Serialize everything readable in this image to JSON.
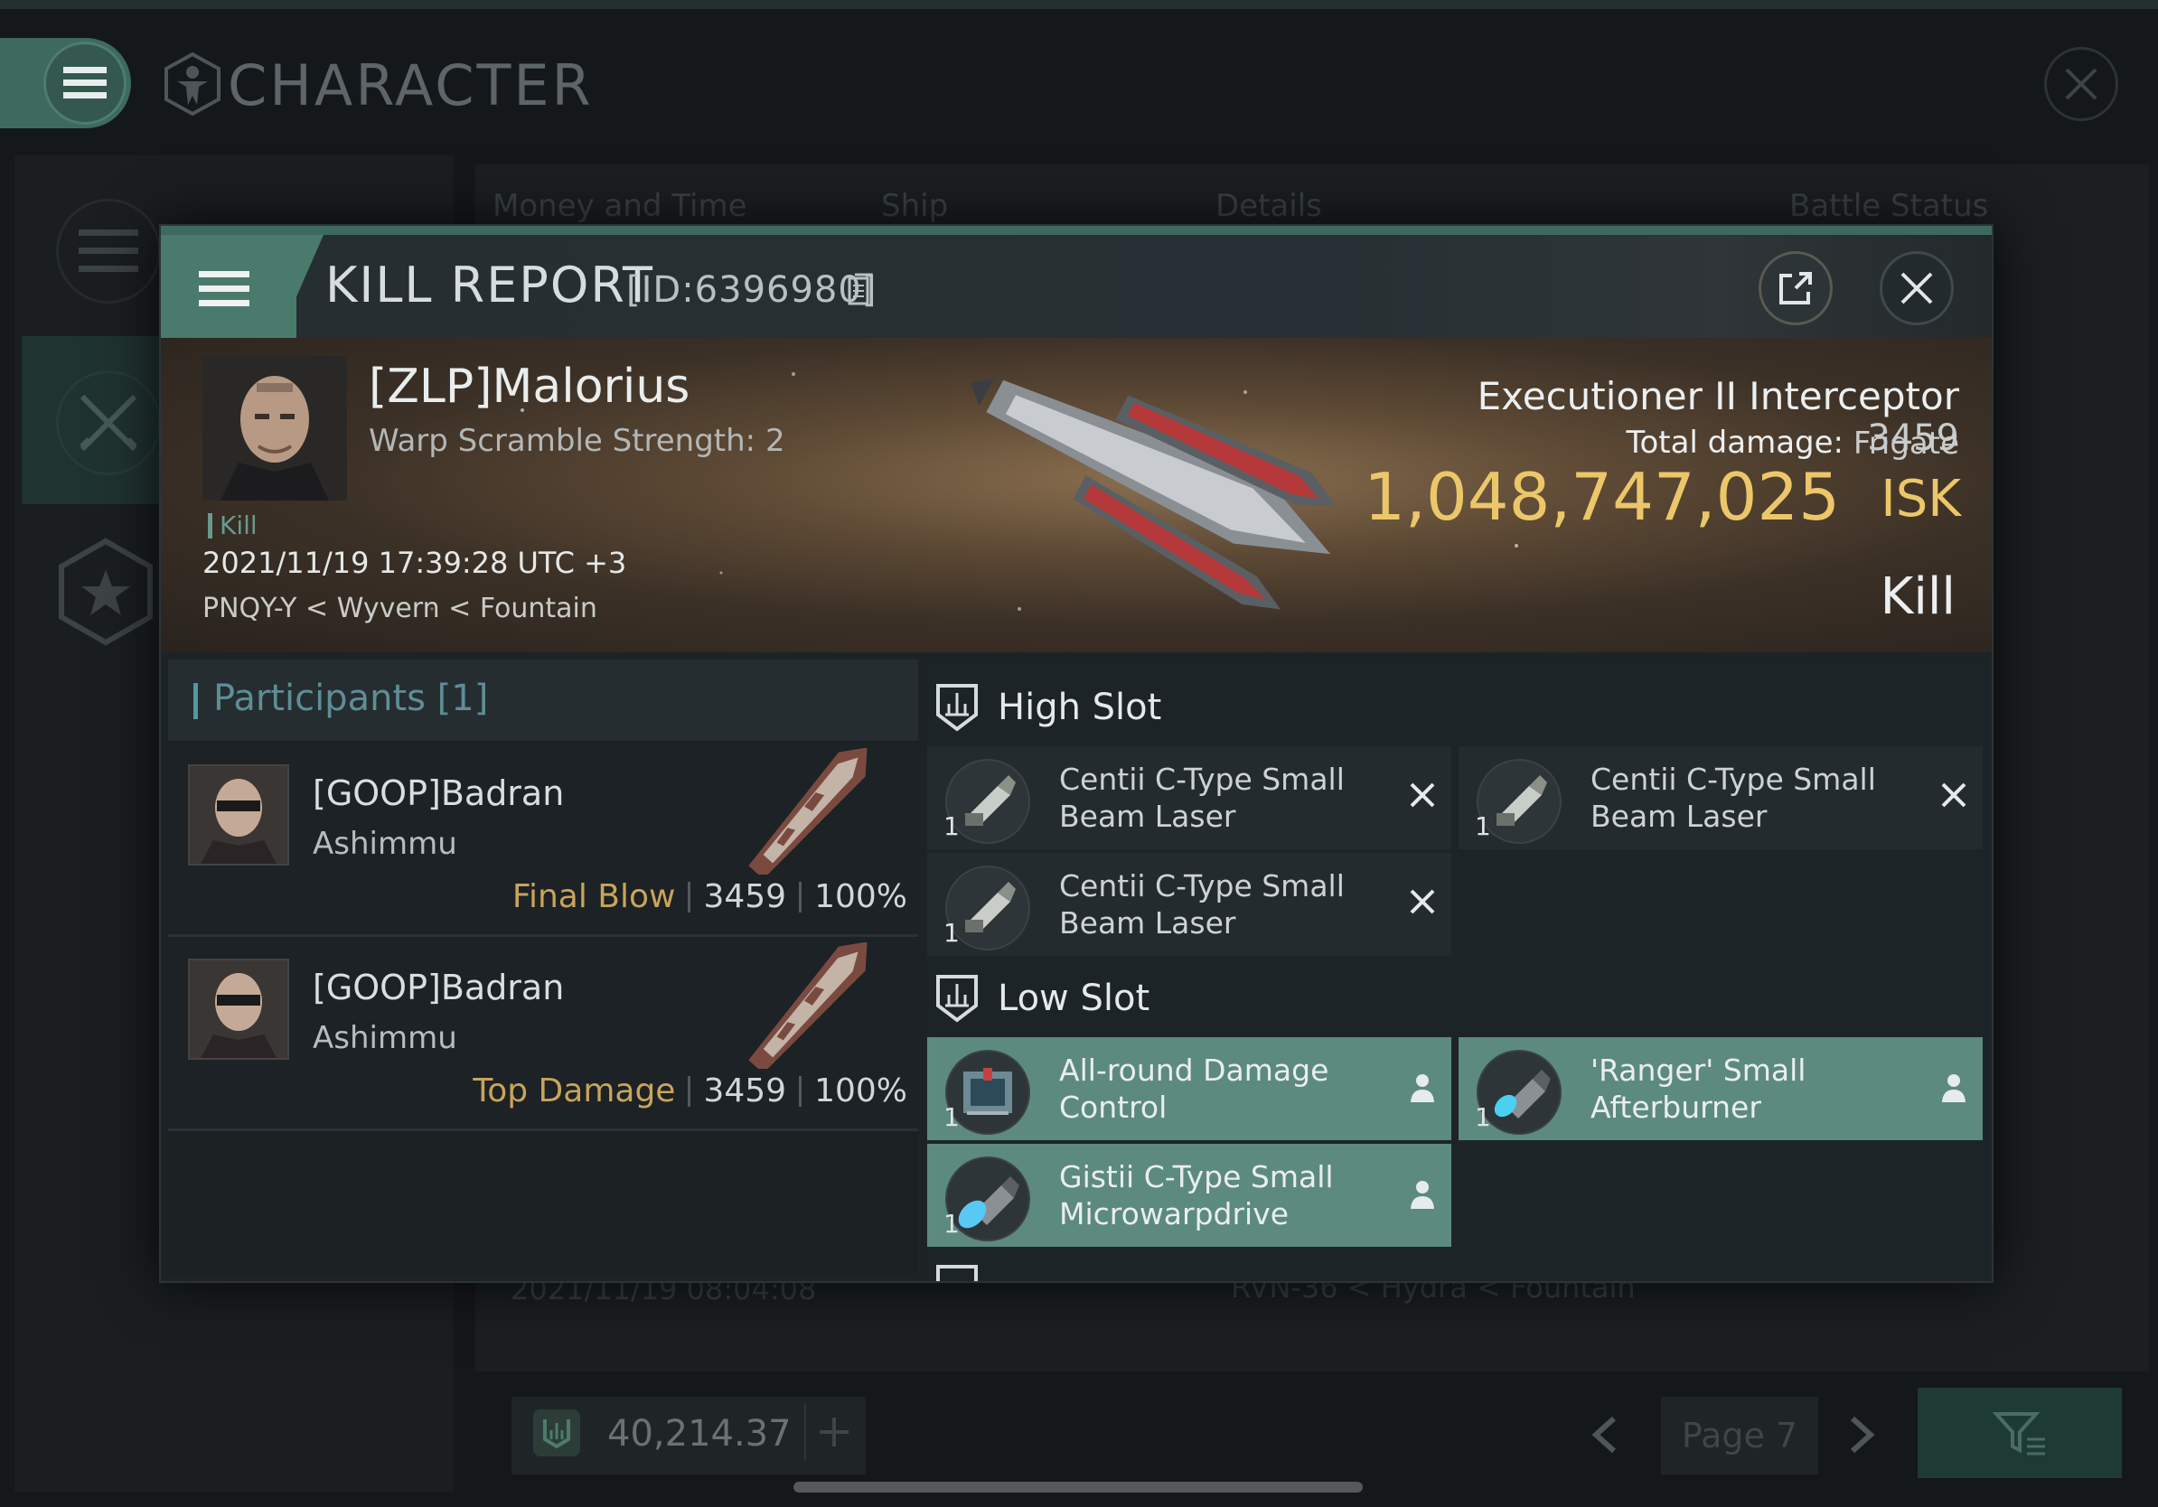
{
  "screen": {
    "title": "CHARACTER",
    "tabs": [
      "Money and Time",
      "Ship",
      "Details",
      "Battle Status"
    ],
    "background_row": {
      "date": "2021/11/19  08:04:08",
      "location": "RVN-36 < Hydra < Fountain"
    },
    "wallet": {
      "amount": "40,214.37"
    },
    "pagination": {
      "page_label": "Page 7"
    }
  },
  "kill_report": {
    "title": "KILL REPORT",
    "id_label": "[ID:6396980]",
    "victim": {
      "name": "[ZLP]Malorius",
      "subtitle": "Warp Scramble Strength: 2",
      "tag": "Kill",
      "time": "2021/11/19 17:39:28 UTC +3",
      "location": "PNQY-Y < Wyvern < Fountain"
    },
    "ship": {
      "name": "Executioner II Interceptor",
      "class": "Frigate",
      "total_damage_label": "Total damage:",
      "total_damage": "3459",
      "isk_value": "1,048,747,025",
      "isk_unit": "ISK",
      "status": "Kill"
    },
    "participants": {
      "title": "Participants [1]",
      "rows": [
        {
          "name": "[GOOP]Badran",
          "ship": "Ashimmu",
          "role": "Final Blow",
          "damage": "3459",
          "percent": "100%"
        },
        {
          "name": "[GOOP]Badran",
          "ship": "Ashimmu",
          "role": "Top Damage",
          "damage": "3459",
          "percent": "100%"
        }
      ]
    },
    "slots": {
      "high": {
        "title": "High Slot",
        "items": [
          {
            "name": "Centii C-Type Small Beam Laser",
            "qty": "1",
            "state": "destroyed",
            "icon": "beam-laser-icon"
          },
          {
            "name": "Centii C-Type Small Beam Laser",
            "qty": "1",
            "state": "destroyed",
            "icon": "beam-laser-icon"
          },
          {
            "name": "Centii C-Type Small Beam Laser",
            "qty": "1",
            "state": "destroyed",
            "icon": "beam-laser-icon"
          }
        ]
      },
      "low": {
        "title": "Low Slot",
        "items": [
          {
            "name": "All-round Damage Control",
            "qty": "1",
            "state": "dropped",
            "icon": "damage-control-icon"
          },
          {
            "name": "'Ranger' Small Afterburner",
            "qty": "1",
            "state": "dropped",
            "icon": "afterburner-icon"
          },
          {
            "name": "Gistii C-Type Small Microwarpdrive",
            "qty": "1",
            "state": "dropped",
            "icon": "microwarpdrive-icon"
          }
        ]
      }
    },
    "colors": {
      "accent": "#4a7a6c",
      "isk": "#ecc76a",
      "fitted": "#5d8a7e",
      "role": "#c9a45a",
      "participants_title": "#5e8e96"
    }
  }
}
